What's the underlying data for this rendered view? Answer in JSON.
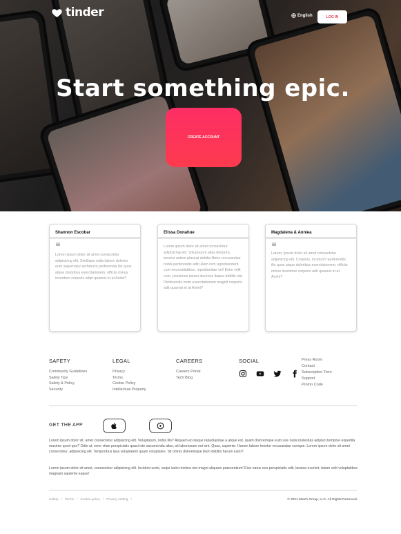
{
  "header": {
    "brand": "tinder",
    "language_label": "English",
    "login_label": "LOG IN"
  },
  "hero": {
    "title": "Start something epic.",
    "cta_label": "CREATE ACCOUNT"
  },
  "testimonials": [
    {
      "name": "Shannon Escobar",
      "text": "Lorem ipsum dolor sit amet consectetur adipisicing elit. Similique nulla labore dolores eum aspernatur architecto perferendis illo quos atque doloribus exercitationem, officiis minus inventore corporis adipi quaerat et at Animi?"
    },
    {
      "name": "Elissa Donahue",
      "text": "Lorem ipsum dolor sit amet consectetur adipisicing elit. Voluptatum alias tempora, tenetur autem placeat debitis libero recusandae nobis perferendis adit ullam rem reprehenderit cum necessitatibus, repudiandae vel! Enim velit cum, possimus ipsum ducimus itaque debitis nisi Perferendis enim exercitationem magnit corporis adit quaerat et at Animi?"
    },
    {
      "name": "Magdalena & Anniea",
      "text": "Lorem, ipsum dolor sit amet consectetur adipisicing elit. Corporis, incidunt? perferendis illo quos atque doloribus exercitationem, officiis minus inventore corporis adit quaerat et at Animi?"
    }
  ],
  "footer": {
    "columns": [
      {
        "title": "SAFETY",
        "items": [
          "Community Guidelines",
          "Safety Tips",
          "Safety & Policy",
          "Security"
        ]
      },
      {
        "title": "LEGAL",
        "items": [
          "Privacy",
          "Terms",
          "Cookie Policy",
          "Intellectual Property"
        ]
      },
      {
        "title": "CAREERS",
        "items": [
          "Careers Portal",
          "Tech Blog"
        ]
      }
    ],
    "social_title": "SOCIAL",
    "social_icons": [
      "instagram-icon",
      "youtube-icon",
      "twitter-icon",
      "facebook-icon"
    ],
    "extra_links": [
      "Press Room",
      "Contact",
      "Subscription Tiers",
      "Support",
      "Promo Code"
    ],
    "get_app_label": "GET THE APP",
    "store_icons": [
      "apple-icon",
      "google-play-icon"
    ],
    "paragraph_1": "Lorem ipsum dolor sit, amet consectetur adipisicing elit. Voluptatum, nobis illo? Aliquam eo itaque repudiandae a atque est, quam doloremque eum iure nulla molestias adipisci tempore expedita maxime quod quo? Odio ut, error vitae perspiciatis quasi iste assumenda alias, sit laboriosam est sint. Quas, sapiente. Harum labore tenetur recusandae cumque. Lorem ipsum dolor sit amet consectetur, adipisicing elit. Temporibus ipsa voluptatem quam voluptates. Sit omnis doloremque illum debitis harum iusto?",
    "paragraph_2": "Lorem ipsum dolor sit amet, consectetur adipisicing elit. Incidunt unde, sequi iusto minima nisi magni aliquam praesentium! Eius natus eos perspiciatis odit, beatae eveniet, totam velit voluptatibus magnam sapiente eaque!",
    "bottom_links": [
      "Safety",
      "Terms",
      "Cookie policy",
      "Privacy setting"
    ],
    "copyright": "© 2021 Match Group, LLC, All Rights Reserved."
  },
  "colors": {
    "brand_gradient_start": "#fd2e64",
    "brand_gradient_end": "#fd3a4e",
    "login_text": "#e4344b"
  }
}
